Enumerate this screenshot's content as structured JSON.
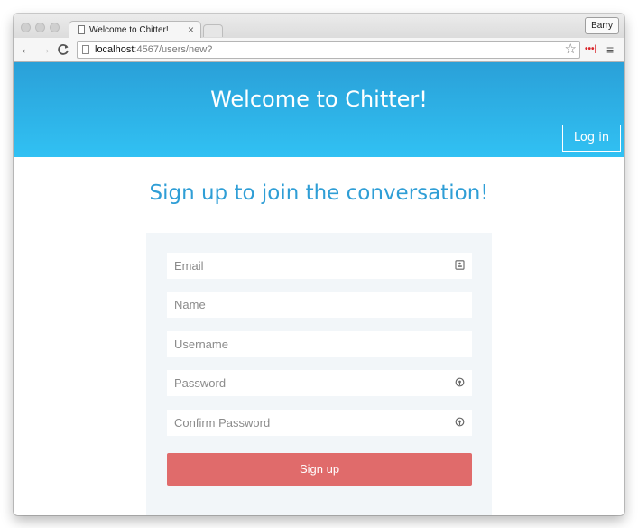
{
  "browser": {
    "tab_title": "Welcome to Chitter!",
    "tab_close": "×",
    "profile_name": "Barry",
    "url_host": "localhost",
    "url_path": ":4567/users/new?",
    "back_icon": "←",
    "forward_icon": "→",
    "reload_icon": "C",
    "star_icon": "☆",
    "extension_icon": "•••|",
    "menu_icon": "≡"
  },
  "header": {
    "title": "Welcome to Chitter!",
    "login_label": "Log in",
    "gradient_top": "#2aa0d8",
    "gradient_bottom": "#31c1f3"
  },
  "main": {
    "headline": "Sign up to join the conversation!",
    "form": {
      "fields": [
        {
          "placeholder": "Email",
          "icon": "contact-card-icon"
        },
        {
          "placeholder": "Name",
          "icon": ""
        },
        {
          "placeholder": "Username",
          "icon": ""
        },
        {
          "placeholder": "Password",
          "icon": "key-icon"
        },
        {
          "placeholder": "Confirm Password",
          "icon": "key-icon"
        }
      ],
      "submit_label": "Sign up",
      "submit_color": "#e06b6b"
    }
  }
}
